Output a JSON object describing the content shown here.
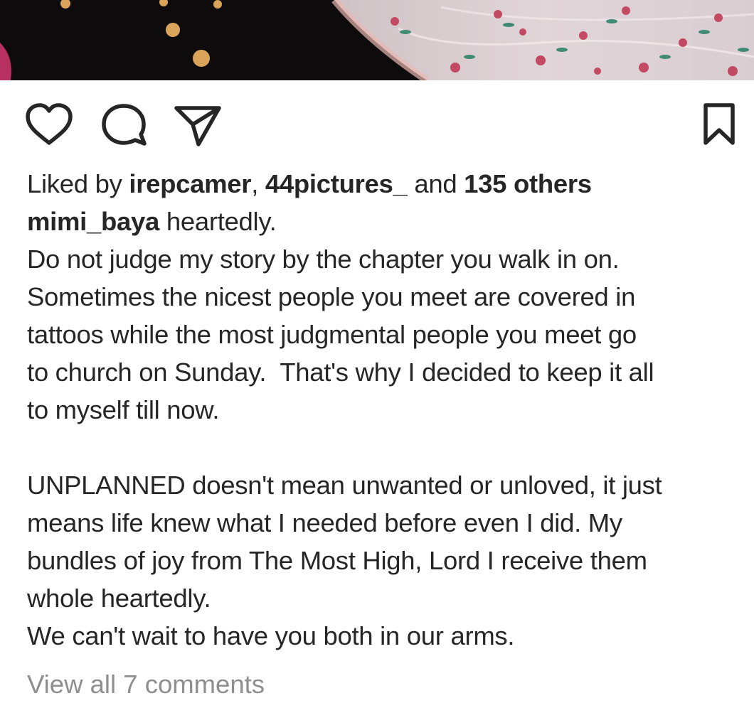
{
  "post": {
    "image_alt": "post-photo",
    "actions": {
      "like_icon": "heart-icon",
      "comment_icon": "comment-bubble-icon",
      "share_icon": "paper-plane-icon",
      "save_icon": "bookmark-icon"
    },
    "likes": {
      "prefix": "Liked by ",
      "user1": "irepcamer",
      "sep": ", ",
      "user2": "44pictures_",
      "and": " and ",
      "others": "135 others"
    },
    "caption": {
      "username": "mimi_baya",
      "first_text": " heartedly.",
      "lines": [
        "Do not judge my story by the chapter you walk in on.",
        "Sometimes the nicest people you meet are covered in",
        "tattoos while the most judgmental people you meet go",
        "to church on Sunday.  That's why I decided to keep it all",
        "to myself till now."
      ],
      "lines2": [
        "UNPLANNED doesn't mean unwanted or unloved, it just",
        "means life knew what I needed before even I did. My",
        "bundles of joy from The Most High, Lord I receive them",
        "whole heartedly.",
        "We can't wait to have you both in our arms."
      ]
    },
    "view_comments": "View all 7 comments"
  },
  "colors": {
    "text": "#262626",
    "muted": "#8e8e8e",
    "background": "#ffffff"
  }
}
